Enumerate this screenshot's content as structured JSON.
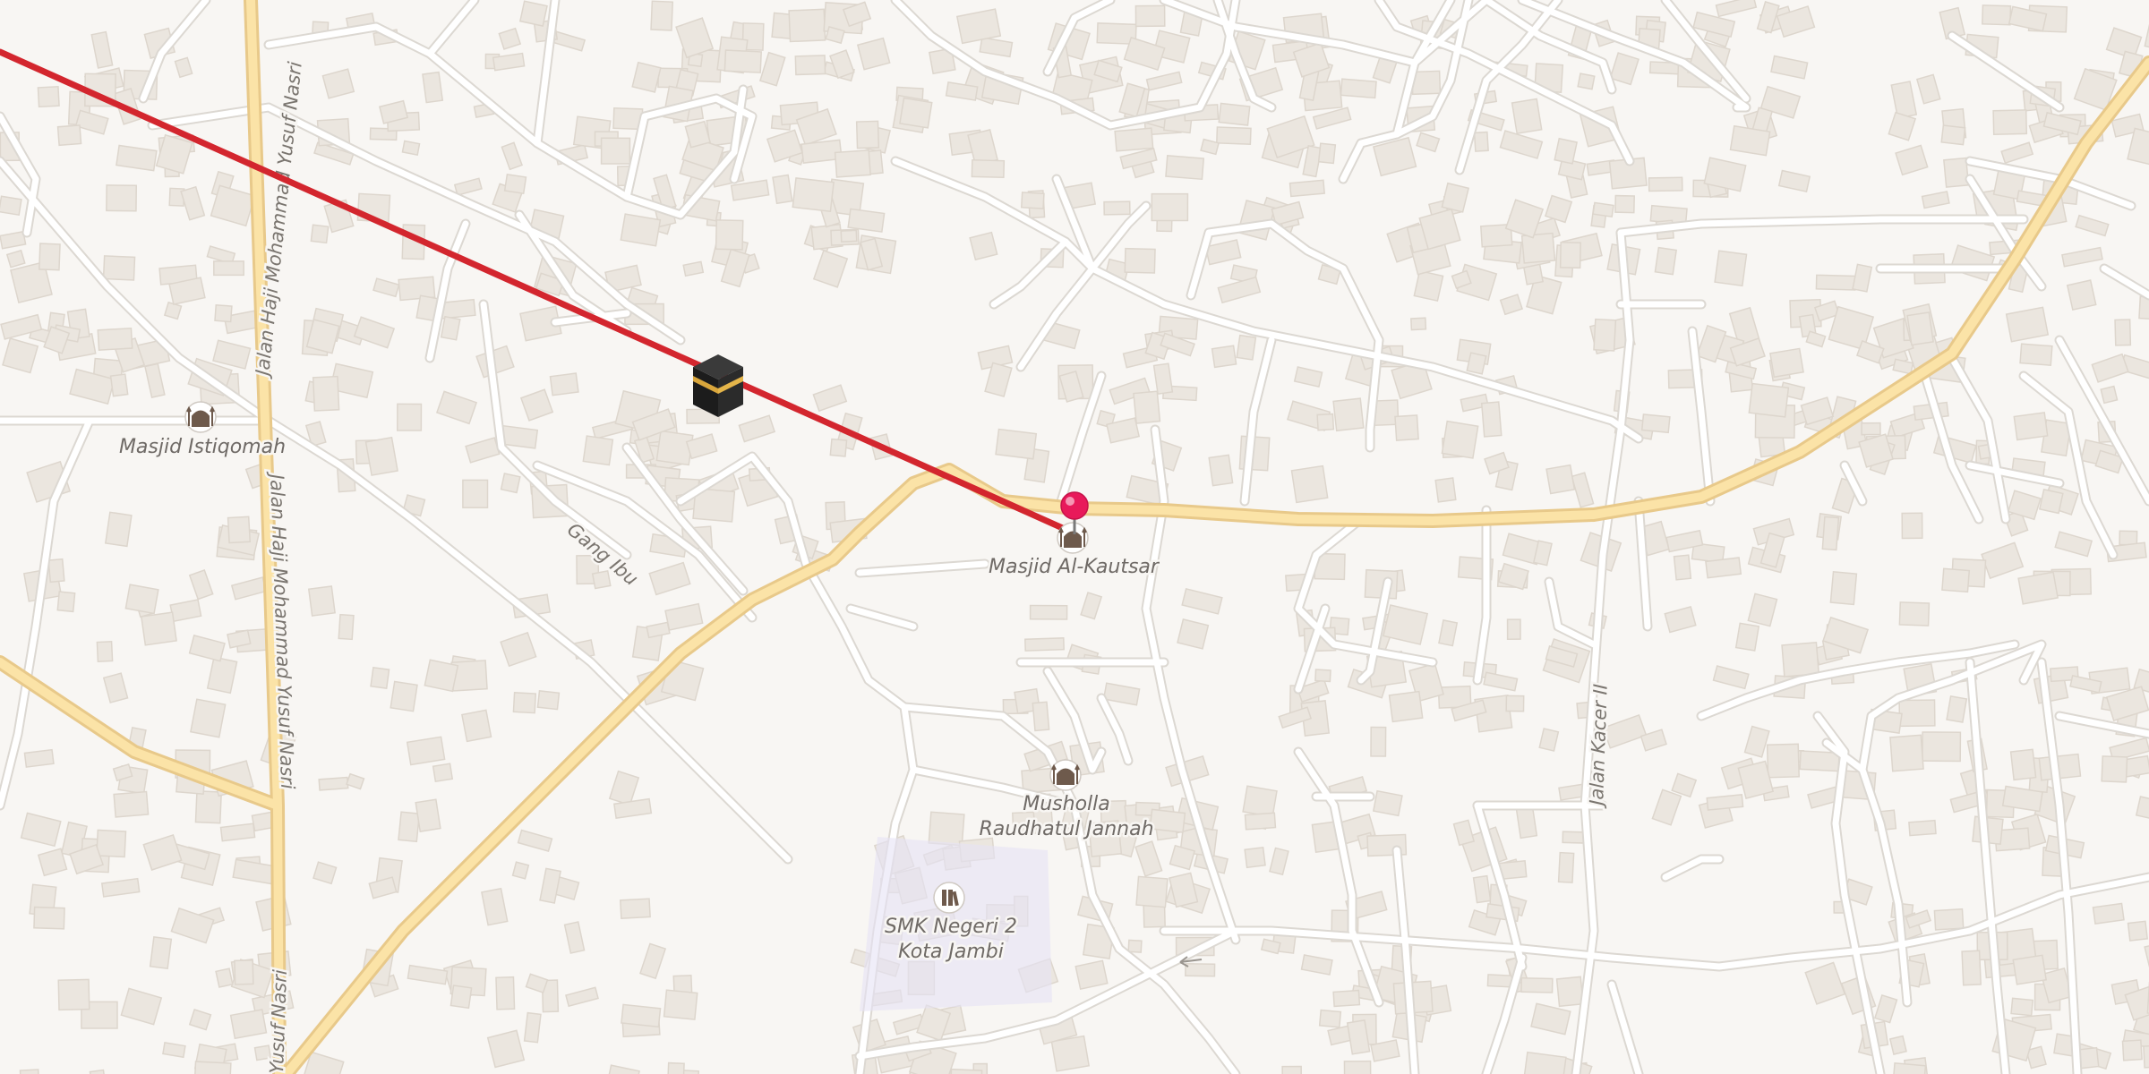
{
  "map": {
    "pois": [
      {
        "name": "Masjid Istiqomah",
        "icon": "mosque-icon"
      },
      {
        "name": "Masjid Al-Kautsar",
        "icon": "mosque-icon"
      },
      {
        "name": "Musholla\nRaudhatul Jannah",
        "line1": "Musholla",
        "line2": "Raudhatul Jannah",
        "icon": "mosque-icon"
      },
      {
        "name": "SMK Negeri 2\nKota Jambi",
        "line1": "SMK Negeri 2",
        "line2": "Kota Jambi",
        "icon": "school-icon"
      }
    ],
    "streets": {
      "yusuf_nasri": "Jalan Haji Mohammad Yusuf Nasri",
      "gang_ibu": "Gang Ibu",
      "kacer_ii": "Jalan Kacer II",
      "yusuf_nasri_short": "Yusuf Nasri"
    },
    "qibla_marker": "kaaba-icon",
    "location_pin": "map-pin-icon",
    "colors": {
      "background": "#f8f6f3",
      "qibla_line": "#d3262e",
      "pin": "#e8195a",
      "primary_road": "#fbe3a7"
    }
  }
}
